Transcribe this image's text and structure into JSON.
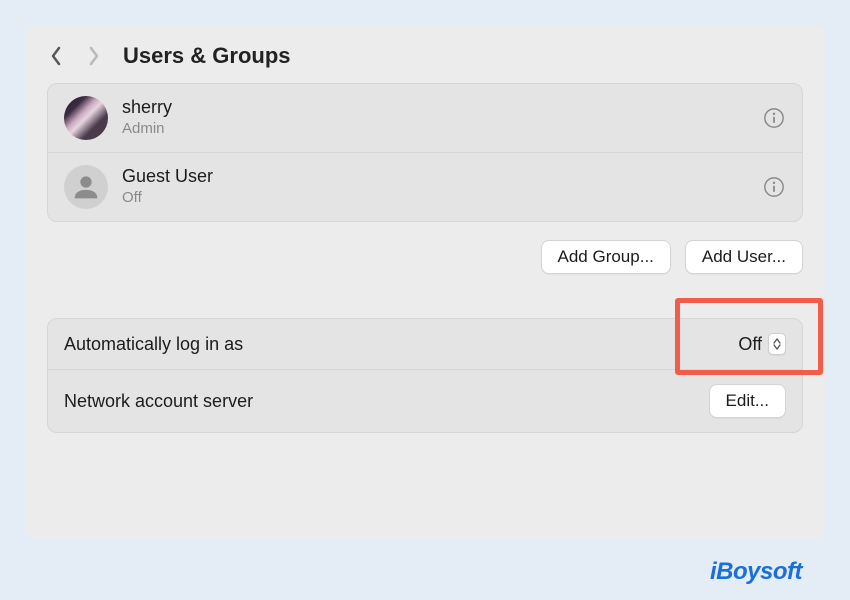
{
  "header": {
    "title": "Users & Groups"
  },
  "users": [
    {
      "name": "sherry",
      "role": "Admin",
      "avatar_type": "photo"
    },
    {
      "name": "Guest User",
      "role": "Off",
      "avatar_type": "guest"
    }
  ],
  "buttons": {
    "add_group": "Add Group...",
    "add_user": "Add User..."
  },
  "settings": {
    "auto_login_label": "Automatically log in as",
    "auto_login_value": "Off",
    "network_server_label": "Network account server",
    "edit_label": "Edit..."
  },
  "highlight": {
    "color": "#f25c4a"
  },
  "watermark": "iBoysoft"
}
